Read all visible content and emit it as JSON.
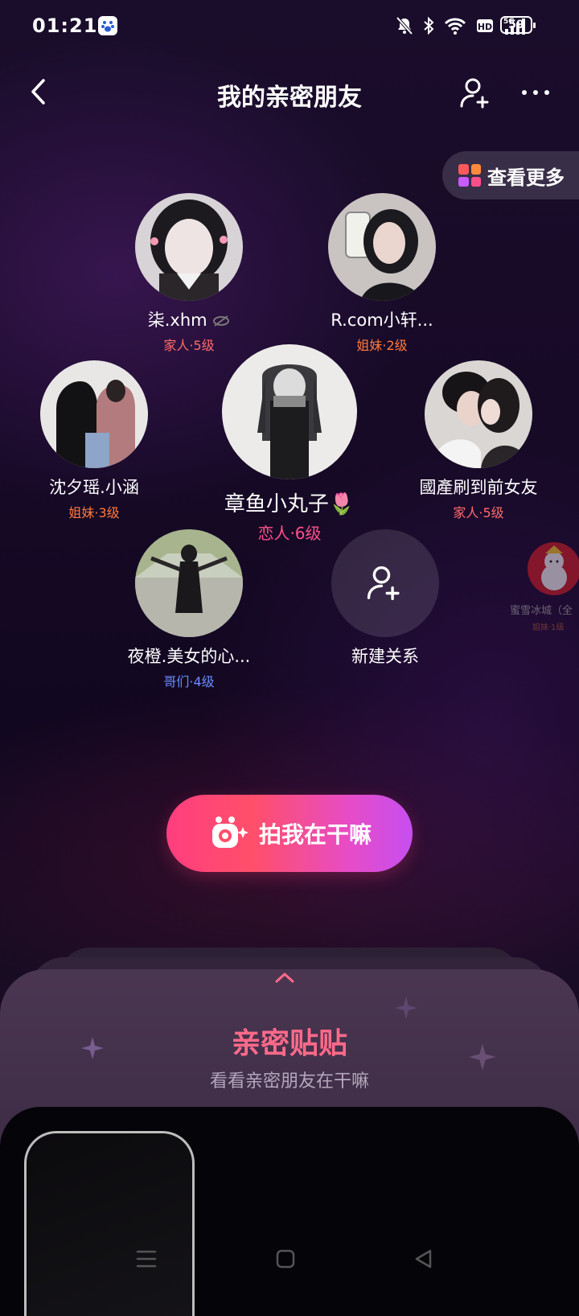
{
  "status_bar": {
    "time": "01:21",
    "battery": "59"
  },
  "header": {
    "title": "我的亲密朋友"
  },
  "view_more": {
    "label": "查看更多"
  },
  "friends": [
    {
      "name": "柒.xhm",
      "level": "家人·5级",
      "level_color": "#ff6b6b"
    },
    {
      "name": "R.com小轩...",
      "level": "姐妹·2级",
      "level_color": "#ff7a3d"
    },
    {
      "name": "沈夕瑶.小涵",
      "level": "姐妹·3级",
      "level_color": "#ff7a3d"
    },
    {
      "name": "章鱼小丸子🌷",
      "level": "恋人·6级",
      "level_color": "#ff4f8b"
    },
    {
      "name": "國產刷到前女友",
      "level": "家人·5级",
      "level_color": "#ff6b6b"
    },
    {
      "name": "夜橙.美女的心...",
      "level": "哥们·4级",
      "level_color": "#6b8cff"
    },
    {
      "name": "蜜雪冰城（全",
      "level": "姐妹·1级",
      "level_color": "#ff7a3d"
    }
  ],
  "new_relation": {
    "label": "新建关系"
  },
  "snap_button": {
    "label": "拍我在干嘛"
  },
  "bottom_sheet": {
    "title": "亲密贴贴",
    "subtitle": "看看亲密朋友在干嘛"
  },
  "colors": {
    "accent_pink": "#ff4f8b",
    "button_gradient_start": "#ff3e7f",
    "button_gradient_end": "#c64ef0"
  }
}
